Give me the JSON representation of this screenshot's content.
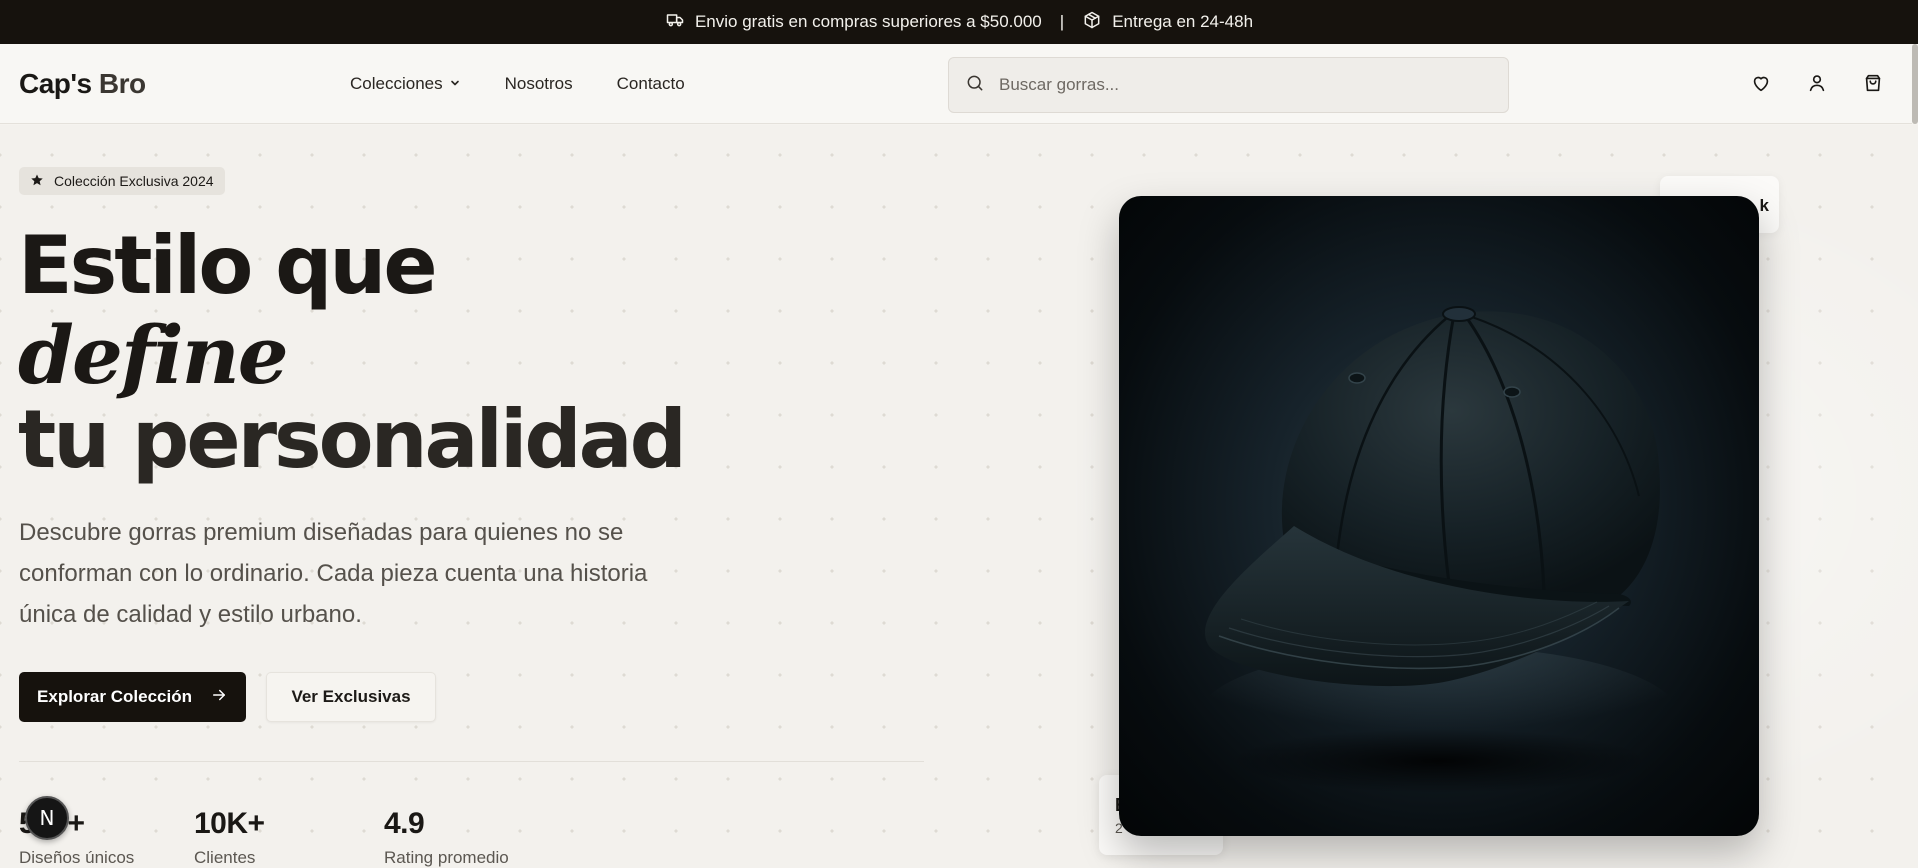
{
  "topbar": {
    "shipping_text": "Envio gratis en compras superiores a $50.000",
    "separator": "|",
    "delivery_text": "Entrega en 24-48h"
  },
  "header": {
    "logo_first": "Cap's",
    "logo_second": "Bro",
    "nav": {
      "collections": "Colecciones",
      "about": "Nosotros",
      "contact": "Contacto"
    },
    "search_placeholder": "Buscar gorras..."
  },
  "hero": {
    "badge": "Colección Exclusiva 2024",
    "headline_line1": "Estilo que",
    "headline_line2": "define",
    "headline_line3": "tu personalidad",
    "description": "Descubre gorras premium diseñadas para quienes no se conforman con lo ordinario. Cada pieza cuenta una historia única de calidad y estilo urbano.",
    "primary_button": "Explorar Colección",
    "secondary_button": "Ver Exclusivas",
    "stats": [
      {
        "value": "500+",
        "label": "Diseños únicos"
      },
      {
        "value": "10K+",
        "label": "Clientes satisfechos"
      },
      {
        "value": "4.9",
        "label": "Rating promedio"
      }
    ]
  },
  "floating": {
    "top_card_text": "k",
    "bottom_card_title": "E",
    "bottom_card_sub": "2"
  },
  "fab_label": "N",
  "colors": {
    "topbar_bg": "#16120d",
    "primary_button": "#16120d",
    "page_bg": "#f5f3ef"
  }
}
